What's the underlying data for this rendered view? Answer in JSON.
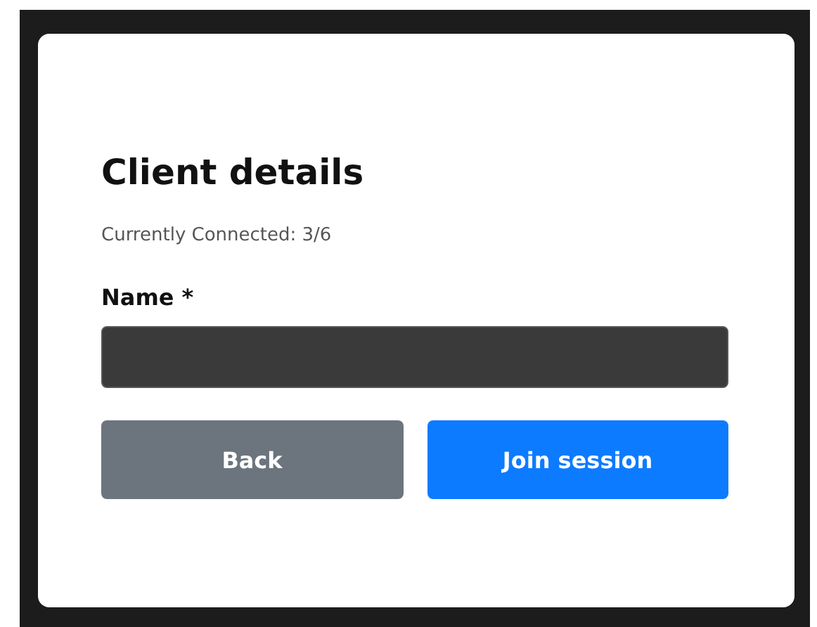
{
  "title": "Client details",
  "status": "Currently Connected: 3/6",
  "name_field": {
    "label": "Name *"
  },
  "buttons": [
    {
      "label": "Back",
      "kind": "secondary"
    },
    {
      "label": "Join session",
      "kind": "primary"
    }
  ]
}
